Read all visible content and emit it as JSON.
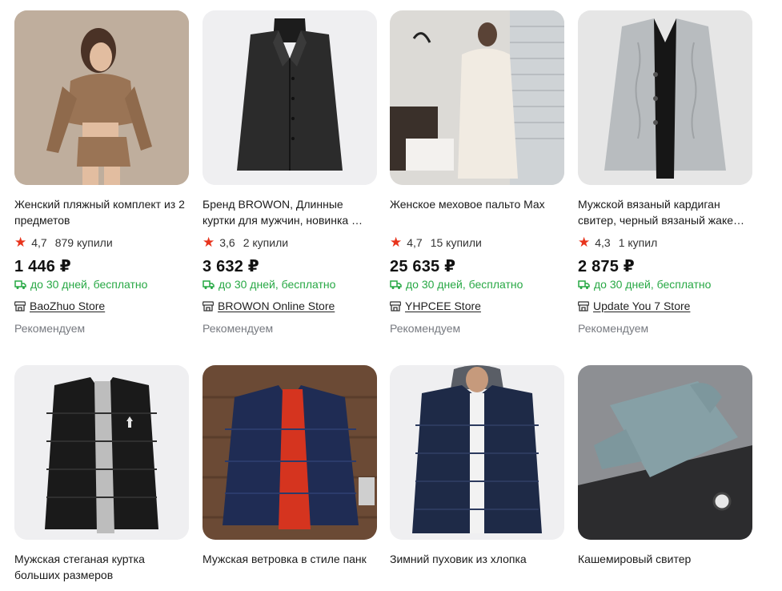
{
  "products": [
    {
      "title": "Женский пляжный комплект из 2 предметов",
      "rating": "4,7",
      "bought": "879 купили",
      "price": "1 446 ₽",
      "delivery": "до 30 дней, бесплатно",
      "store": "BaoZhuo Store",
      "badge": "Рекомендуем",
      "image": "woman-knit-set-photo"
    },
    {
      "title": "Бренд BROWON, Длинные куртки для мужчин, новинка …",
      "rating": "3,6",
      "bought": "2 купили",
      "price": "3 632 ₽",
      "delivery": "до 30 дней, бесплатно",
      "store": "BROWON Online Store",
      "badge": "Рекомендуем",
      "image": "black-coat-photo"
    },
    {
      "title": "Женское меховое пальто Max",
      "rating": "4,7",
      "bought": "15 купили",
      "price": "25 635 ₽",
      "delivery": "до 30 дней, бесплатно",
      "store": "YHPCEE Store",
      "badge": "Рекомендуем",
      "image": "white-fur-coat-photo"
    },
    {
      "title": "Мужской вязаный кардиган свитер, черный вязаный жаке…",
      "rating": "4,3",
      "bought": "1 купил",
      "price": "2 875 ₽",
      "delivery": "до 30 дней, бесплатно",
      "store": "Update You 7 Store",
      "badge": "Рекомендуем",
      "image": "grey-cardigan-photo"
    },
    {
      "title": "Мужская стеганая куртка больших размеров",
      "image": "black-puffer-jacket-photo"
    },
    {
      "title": "Мужская ветровка в стиле панк",
      "image": "navy-windbreaker-photo"
    },
    {
      "title": "Зимний пуховик из хлопка",
      "image": "navy-hooded-puffer-photo"
    },
    {
      "title": "Кашемировый свитер",
      "image": "turtleneck-sweater-photo"
    }
  ],
  "icons": {
    "star": "star-icon",
    "truck": "truck-icon",
    "store": "store-icon"
  },
  "colors": {
    "star": "#e8341d",
    "delivery": "#27a844",
    "badge": "#777a80"
  }
}
